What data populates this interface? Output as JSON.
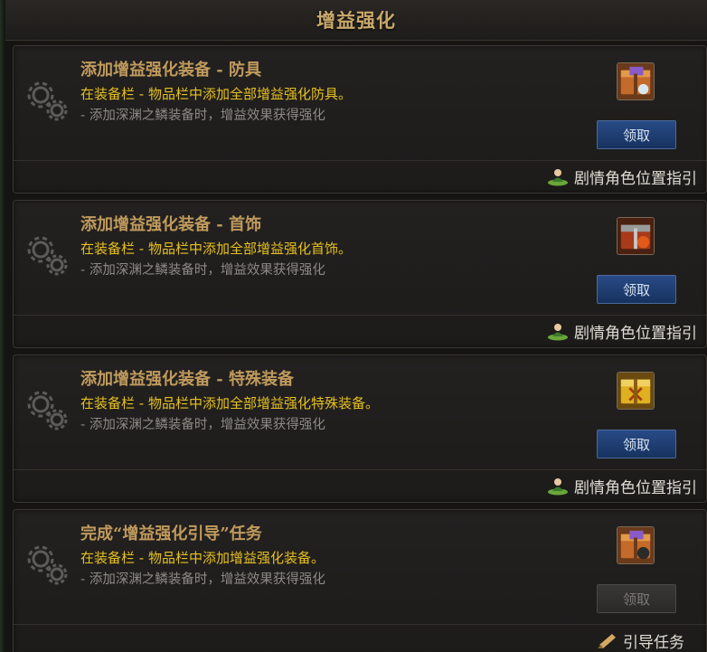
{
  "header": {
    "title": "增益强化"
  },
  "quests": [
    {
      "title": "添加增益强化装备 - 防具",
      "line1": "在装备栏 - 物品栏中添加全部增益强化防具。",
      "line2": "- 添加深渊之鳞装备时，增益效果获得强化",
      "button": "领取",
      "button_enabled": true,
      "reward_icon": "armor-box-icon",
      "footer": "剧情角色位置指引",
      "footer_icon": "npc-location-icon"
    },
    {
      "title": "添加增益强化装备 - 首饰",
      "line1": "在装备栏 - 物品栏中添加全部增益强化首饰。",
      "line2": "- 添加深渊之鳞装备时，增益效果获得强化",
      "button": "领取",
      "button_enabled": true,
      "reward_icon": "accessory-box-icon",
      "footer": "剧情角色位置指引",
      "footer_icon": "npc-location-icon"
    },
    {
      "title": "添加增益强化装备 - 特殊装备",
      "line1": "在装备栏 - 物品栏中添加全部增益强化特殊装备。",
      "line2": "- 添加深渊之鳞装备时，增益效果获得强化",
      "button": "领取",
      "button_enabled": true,
      "reward_icon": "special-box-icon",
      "footer": "剧情角色位置指引",
      "footer_icon": "npc-location-icon"
    },
    {
      "title": "完成“增益强化引导”任务",
      "line1": "在装备栏 - 物品栏中添加增益强化装备。",
      "line2": "- 添加深渊之鳞装备时，增益效果获得强化",
      "button": "领取",
      "button_enabled": false,
      "reward_icon": "guide-box-icon",
      "footer": "引导任务",
      "footer_icon": "scroll-icon"
    }
  ],
  "colors": {
    "title_gold": "#c09a5c",
    "line_yellow": "#e6c020",
    "line_gray": "#8d8a86",
    "button_blue": "#284a86"
  }
}
